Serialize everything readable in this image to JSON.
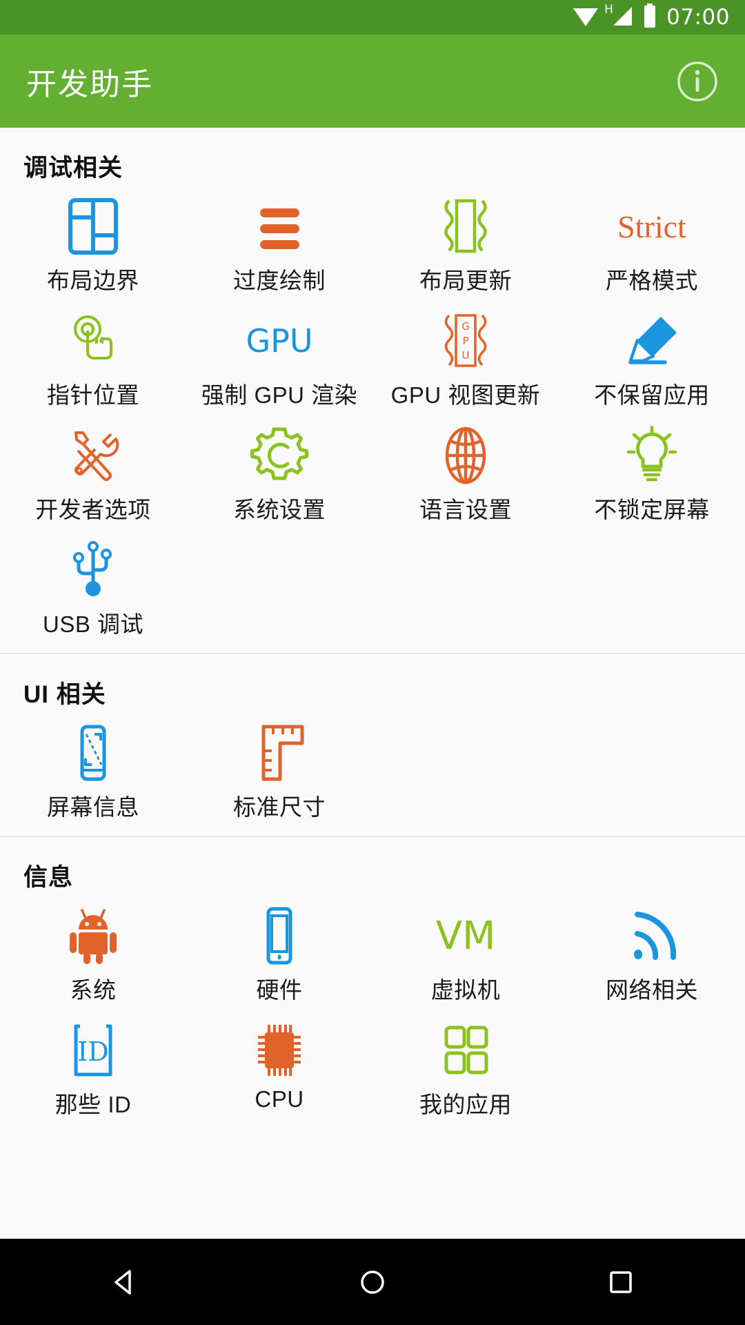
{
  "status_bar": {
    "background": "#4a9425",
    "wifi_icon": "wifi-icon",
    "signal_label": "H",
    "signal_icon": "cellular-signal-icon",
    "battery_icon": "battery-icon",
    "time": "07:00"
  },
  "app_bar": {
    "background": "#62af32",
    "title": "开发助手",
    "info_label": "i",
    "info_icon": "info-icon"
  },
  "sections": [
    {
      "title": "调试相关",
      "items": [
        {
          "label": "布局边界",
          "icon": "layout-bounds-icon",
          "color": "#1b95e0"
        },
        {
          "label": "过度绘制",
          "icon": "overdraw-icon",
          "color": "#e2622c"
        },
        {
          "label": "布局更新",
          "icon": "layout-update-icon",
          "color": "#8cc220"
        },
        {
          "label": "严格模式",
          "icon": "strict-mode-icon",
          "color": "#e2622c",
          "glyph": "Strict"
        },
        {
          "label": "指针位置",
          "icon": "pointer-location-icon",
          "color": "#8cc220"
        },
        {
          "label": "强制 GPU 渲染",
          "icon": "force-gpu-icon",
          "color": "#1b95e0",
          "glyph": "GPU"
        },
        {
          "label": "GPU 视图更新",
          "icon": "gpu-view-update-icon",
          "color": "#e2622c",
          "glyph": "GPU"
        },
        {
          "label": "不保留应用",
          "icon": "eraser-icon",
          "color": "#1b95e0"
        },
        {
          "label": "开发者选项",
          "icon": "tools-icon",
          "color": "#e2622c"
        },
        {
          "label": "系统设置",
          "icon": "gear-icon",
          "color": "#8cc220"
        },
        {
          "label": "语言设置",
          "icon": "globe-icon",
          "color": "#e2622c"
        },
        {
          "label": "不锁定屏幕",
          "icon": "lightbulb-icon",
          "color": "#8cc220"
        },
        {
          "label": "USB 调试",
          "icon": "usb-icon",
          "color": "#1b95e0"
        }
      ]
    },
    {
      "title": "UI 相关",
      "items": [
        {
          "label": "屏幕信息",
          "icon": "screen-info-icon",
          "color": "#1b95e0"
        },
        {
          "label": "标准尺寸",
          "icon": "ruler-icon",
          "color": "#e2622c"
        }
      ]
    },
    {
      "title": "信息",
      "items": [
        {
          "label": "系统",
          "icon": "android-robot-icon",
          "color": "#e2622c"
        },
        {
          "label": "硬件",
          "icon": "phone-icon",
          "color": "#1b95e0"
        },
        {
          "label": "虚拟机",
          "icon": "vm-icon",
          "color": "#8cc220",
          "glyph": "VM"
        },
        {
          "label": "网络相关",
          "icon": "signal-waves-icon",
          "color": "#1b95e0"
        },
        {
          "label": "那些 ID",
          "icon": "id-card-icon",
          "color": "#1b95e0",
          "glyph": "ID"
        },
        {
          "label": "CPU",
          "icon": "cpu-chip-icon",
          "color": "#e2622c"
        },
        {
          "label": "我的应用",
          "icon": "apps-grid-icon",
          "color": "#8cc220"
        }
      ]
    }
  ],
  "nav_bar": {
    "back_icon": "back-triangle-icon",
    "home_icon": "home-circle-icon",
    "recents_icon": "recents-square-icon"
  }
}
